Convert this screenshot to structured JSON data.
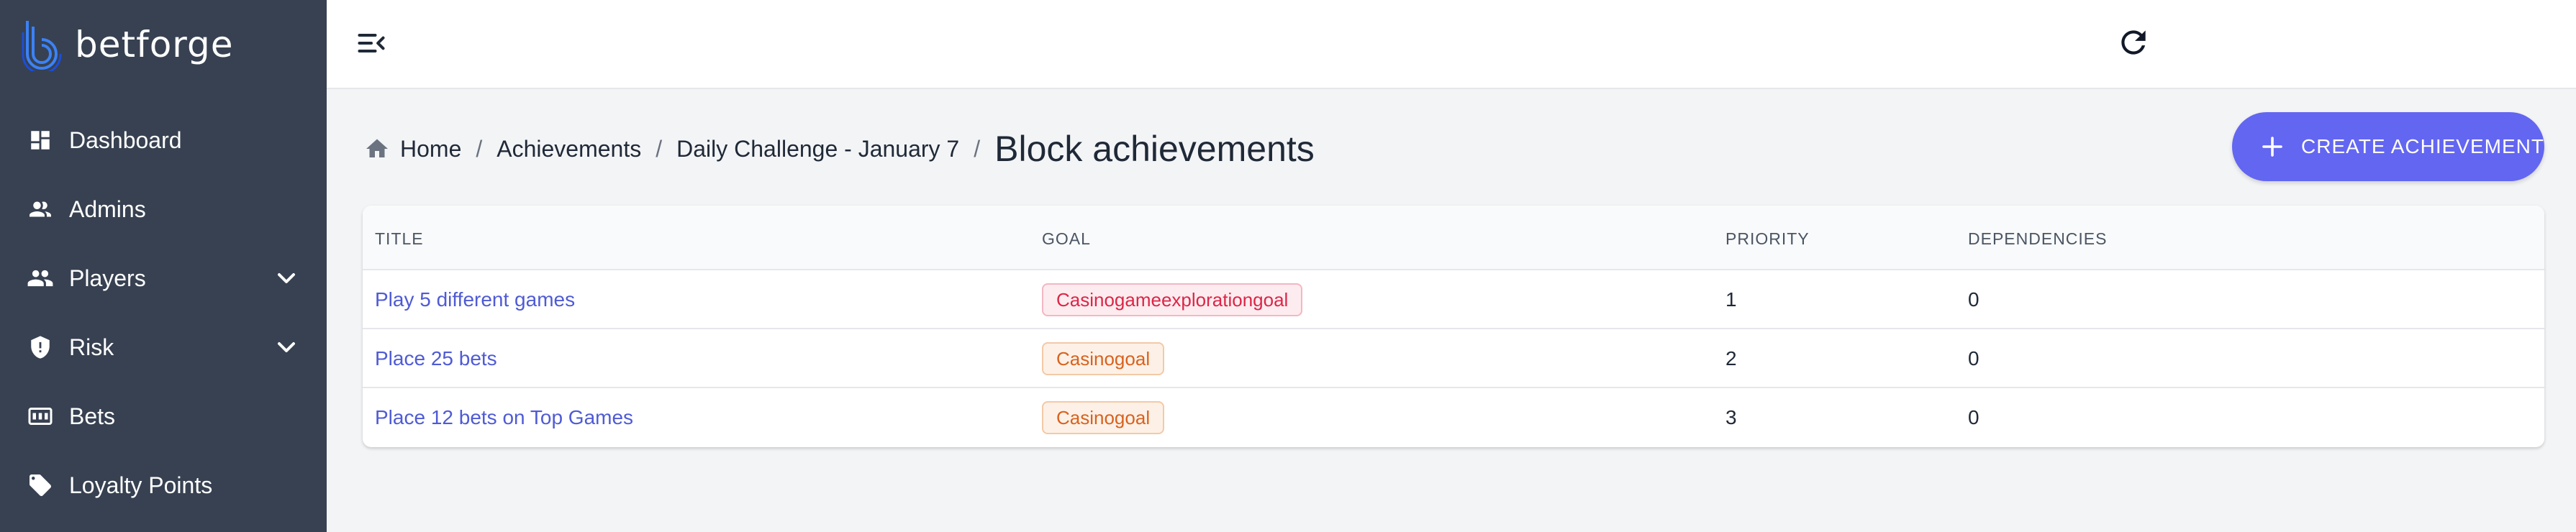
{
  "brand": {
    "name": "betforge",
    "logo_icon": "betforge-logo-icon"
  },
  "sidebar": {
    "items": [
      {
        "label": "Dashboard",
        "icon": "dashboard-icon",
        "has_chevron": false
      },
      {
        "label": "Admins",
        "icon": "admins-icon",
        "has_chevron": false
      },
      {
        "label": "Players",
        "icon": "players-icon",
        "has_chevron": true
      },
      {
        "label": "Risk",
        "icon": "shield-icon",
        "has_chevron": true
      },
      {
        "label": "Bets",
        "icon": "bets-icon",
        "has_chevron": false
      },
      {
        "label": "Loyalty Points",
        "icon": "tag-icon",
        "has_chevron": false
      }
    ]
  },
  "header": {
    "menu_icon": "menu-collapse-icon",
    "refresh_icon": "refresh-icon"
  },
  "breadcrumb": {
    "home": "Home",
    "achievements": "Achievements",
    "challenge": "Daily Challenge - January 7",
    "separator": "/",
    "current": "Block achievements"
  },
  "actions": {
    "create_label": "CREATE ACHIEVEMENT"
  },
  "table": {
    "columns": {
      "title": "TITLE",
      "goal": "GOAL",
      "priority": "PRIORITY",
      "dependencies": "DEPENDENCIES"
    },
    "rows": [
      {
        "title": "Play 5 different games",
        "goal": "Casinogameexplorationgoal",
        "goal_color": "red",
        "priority": "1",
        "dependencies": "0"
      },
      {
        "title": "Place 25 bets",
        "goal": "Casinogoal",
        "goal_color": "orange",
        "priority": "2",
        "dependencies": "0"
      },
      {
        "title": "Place 12 bets on Top Games",
        "goal": "Casinogoal",
        "goal_color": "orange",
        "priority": "3",
        "dependencies": "0"
      }
    ]
  },
  "colors": {
    "sidebar_bg": "#374151",
    "accent": "#6366f1",
    "link": "#4f5bd5",
    "badge_red": "#dc2648",
    "badge_orange": "#d9621e"
  }
}
